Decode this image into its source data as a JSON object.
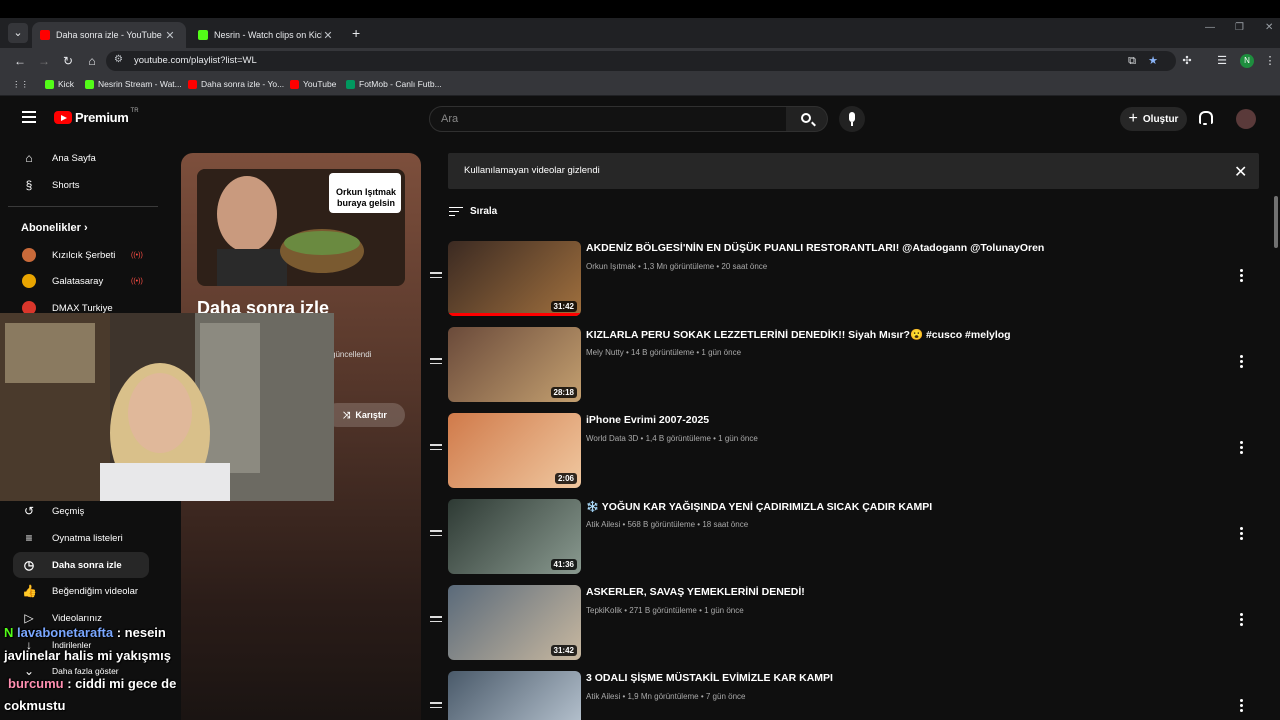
{
  "browser": {
    "tabs": [
      {
        "title": "Daha sonra izle - YouTube",
        "active": true
      },
      {
        "title": "Nesrin - Watch clips on Kick",
        "active": false
      }
    ],
    "url": "youtube.com/playlist?list=WL",
    "profile_initial": "N",
    "bookmarks": [
      {
        "label": "Kick"
      },
      {
        "label": "Nesrin Stream - Wat..."
      },
      {
        "label": "Daha sonra izle - Yo..."
      },
      {
        "label": "YouTube"
      },
      {
        "label": "FotMob - Canlı Futb..."
      }
    ]
  },
  "youtube": {
    "logo_text": "Premium",
    "logo_region": "TR",
    "search_placeholder": "Ara",
    "create_label": "Oluştur",
    "sidebar": {
      "top": [
        {
          "label": "Ana Sayfa",
          "icon": "home-icon"
        },
        {
          "label": "Shorts",
          "icon": "shorts-icon"
        }
      ],
      "subs_header": "Abonelikler",
      "subscriptions": [
        {
          "label": "Kızılcık Şerbeti",
          "color": "#c96a3a"
        },
        {
          "label": "Galatasaray",
          "color": "#e8a400"
        },
        {
          "label": "DMAX Turkiye",
          "color": "#d9362b"
        }
      ],
      "you": [
        {
          "label": "Geçmiş",
          "icon": "history-icon"
        },
        {
          "label": "Oynatma listeleri",
          "icon": "playlists-icon"
        },
        {
          "label": "Daha sonra izle",
          "icon": "watch-later-icon",
          "active": true
        },
        {
          "label": "Beğendiğim videolar",
          "icon": "like-icon"
        },
        {
          "label": "Videolarınız",
          "icon": "your-videos-icon"
        },
        {
          "label": "İndirilenler",
          "icon": "download-icon"
        },
        {
          "label": "Daha fazla göster",
          "icon": "chevron-down-icon"
        }
      ]
    },
    "playlist": {
      "title": "Daha sonra izle",
      "updated": "güncellendi",
      "shuffle_label": "Karıştır",
      "thumb_sticker": "Orkun Işıtmak buraya gelsin"
    },
    "banner_text": "Kullanılamayan videolar gizlendi",
    "sort_label": "Sırala",
    "videos": [
      {
        "title": "AKDENİZ BÖLGESİ'NİN EN DÜŞÜK PUANLI RESTORANTLARI! @Atadogann @TolunayOren",
        "meta": "Orkun Işıtmak • 1,3 Mn görüntüleme • 20 saat önce",
        "duration": "31:42",
        "progress": 1.0,
        "colors": [
          "#3b2a22",
          "#a0703e"
        ]
      },
      {
        "title": "KIZLARLA PERU SOKAK LEZZETLERİNİ DENEDİK!! Siyah Mısır?😮 #cusco #melylog",
        "meta": "Mely Nutty • 14 B görüntüleme • 1 gün önce",
        "duration": "28:18",
        "progress": 0,
        "colors": [
          "#6a4a3a",
          "#c4a070"
        ]
      },
      {
        "title": "iPhone Evrimi 2007-2025",
        "meta": "World Data 3D • 1,4 B görüntüleme • 1 gün önce",
        "duration": "2:06",
        "progress": 0,
        "colors": [
          "#d07a4a",
          "#f0c8a0"
        ]
      },
      {
        "title": "❄️ YOĞUN KAR YAĞIŞINDA YENİ ÇADIRIMIZLA SICAK ÇADIR KAMPI",
        "meta": "Atik Ailesi • 568 B görüntüleme • 18 saat önce",
        "duration": "41:36",
        "progress": 0,
        "colors": [
          "#2e3a34",
          "#8a9a90"
        ]
      },
      {
        "title": "ASKERLER, SAVAŞ YEMEKLERİNİ DENEDİ!",
        "meta": "TepkiKolik • 271 B görüntüleme • 1 gün önce",
        "duration": "31:42",
        "progress": 0,
        "colors": [
          "#5a6a7a",
          "#c8b8a0"
        ]
      },
      {
        "title": "3 ODALI ŞİŞME MÜSTAKİL EVİMİZLE KAR KAMPI",
        "meta": "Atik Ailesi • 1,9 Mn görüntüleme • 7 gün önce",
        "duration": "",
        "progress": 0,
        "colors": [
          "#4a5a6a",
          "#c0ccd8"
        ]
      }
    ]
  },
  "chat": [
    {
      "user": "lavabonetarafta",
      "text": " : nesein",
      "continuation": "javlinelar halis mi yakışmış"
    },
    {
      "user": "burcumu",
      "text": " : ciddi mi gece de",
      "continuation": "cokmustu"
    }
  ]
}
